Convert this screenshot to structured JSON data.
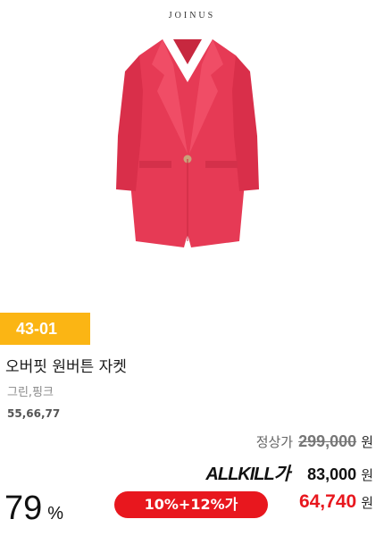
{
  "product": {
    "brand": "JOINUS",
    "image_icon": "jacket-image",
    "code": "43-01",
    "title": "오버핏 원버튼 자켓",
    "colors": "그린,핑크",
    "sizes": "55,66,77"
  },
  "pricing": {
    "regular_label": "정상가",
    "regular_price": "299,000",
    "currency": "원",
    "allkill_logo_prefix": "ALLKILL",
    "allkill_logo_suffix": "가",
    "allkill_price": "83,000",
    "discount_percent": "79",
    "percent_sign": "%",
    "coupon_label": "10%+12%가",
    "final_price": "64,740"
  },
  "colors": {
    "badge": "#fbb514",
    "accent": "#e8171e",
    "jacket": "#e63a55"
  }
}
